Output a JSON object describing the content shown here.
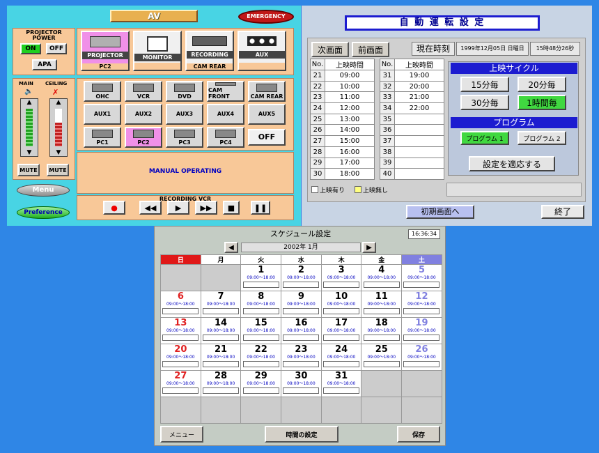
{
  "av": {
    "title": "AV",
    "emergency": "EMERGENCY",
    "projector_power": "PROJECTOR POWER",
    "on": "ON",
    "off": "OFF",
    "apa": "APA",
    "sources": [
      {
        "name": "PROJECTOR",
        "sub": "PC2",
        "selected": true
      },
      {
        "name": "MONITOR",
        "sub": "",
        "selected": false
      },
      {
        "name": "RECORDING",
        "sub": "CAM REAR",
        "selected": false
      },
      {
        "name": "AUX",
        "sub": "",
        "selected": false
      }
    ],
    "main": "MAIN",
    "ceiling": "CEILING",
    "mute1": "MUTE",
    "mute2": "MUTE",
    "inputs_row1": [
      "OHC",
      "VCR",
      "DVD",
      "CAM FRONT",
      "CAM REAR"
    ],
    "inputs_row2": [
      "AUX1",
      "AUX2",
      "AUX3",
      "AUX4",
      "AUX5"
    ],
    "inputs_row3": [
      "PC1",
      "PC2",
      "PC3",
      "PC4"
    ],
    "off_btn": "OFF",
    "manual": "MANUAL OPERATING",
    "menu": "Menu",
    "preference": "Preference",
    "recording_vcr": "RECORDING VCR",
    "vcr": [
      "●",
      "◀◀",
      "▶",
      "▶▶",
      "■",
      "❚❚"
    ]
  },
  "auto": {
    "title": "自 動 運 転 設 定",
    "next": "次画面",
    "prev": "前画面",
    "now_label": "現在時刻",
    "date": "1999年12月05日 日曜日",
    "time": "15時48分26秒",
    "col_no": "No.",
    "col_time": "上映時間",
    "left_rows": [
      [
        "21",
        "09:00"
      ],
      [
        "22",
        "10:00"
      ],
      [
        "23",
        "11:00"
      ],
      [
        "24",
        "12:00"
      ],
      [
        "25",
        "13:00"
      ],
      [
        "26",
        "14:00"
      ],
      [
        "27",
        "15:00"
      ],
      [
        "28",
        "16:00"
      ],
      [
        "29",
        "17:00"
      ],
      [
        "30",
        "18:00"
      ]
    ],
    "right_rows": [
      [
        "31",
        "19:00"
      ],
      [
        "32",
        "20:00"
      ],
      [
        "33",
        "21:00"
      ],
      [
        "34",
        "22:00"
      ],
      [
        "35",
        ""
      ],
      [
        "36",
        ""
      ],
      [
        "37",
        ""
      ],
      [
        "38",
        ""
      ],
      [
        "39",
        ""
      ],
      [
        "40",
        ""
      ]
    ],
    "cycle_title": "上映サイクル",
    "cycles": [
      "15分毎",
      "20分毎",
      "30分毎",
      "1時間毎"
    ],
    "program_title": "プログラム",
    "programs": [
      "プログラム 1",
      "プログラム 2"
    ],
    "apply": "設定を適応する",
    "legend_yes": "上映有り",
    "legend_no": "上映無し",
    "initial": "初期画面へ",
    "end": "終了"
  },
  "sched": {
    "title": "スケジュール設定",
    "clock": "16:36:34",
    "month": "2002年  1月",
    "weekdays": [
      "日",
      "月",
      "火",
      "水",
      "木",
      "金",
      "土"
    ],
    "time_text": "09:00～18:00",
    "weeks": [
      [
        "",
        "",
        "1",
        "2",
        "3",
        "4",
        "5"
      ],
      [
        "6",
        "7",
        "8",
        "9",
        "10",
        "11",
        "12"
      ],
      [
        "13",
        "14",
        "15",
        "16",
        "17",
        "18",
        "19"
      ],
      [
        "20",
        "21",
        "22",
        "23",
        "24",
        "25",
        "26"
      ],
      [
        "27",
        "28",
        "29",
        "30",
        "31",
        "",
        ""
      ],
      [
        "",
        "",
        "",
        "",
        "",
        "",
        ""
      ]
    ],
    "menu": "メニュー",
    "set_time": "時間の設定",
    "save": "保存"
  },
  "colors": {
    "bg": "#2f86e6",
    "cyan": "#48d4e4",
    "orange": "#f8c898",
    "pink": "#f090e8",
    "green": "#40d840",
    "navy": "#1c1cd0"
  }
}
